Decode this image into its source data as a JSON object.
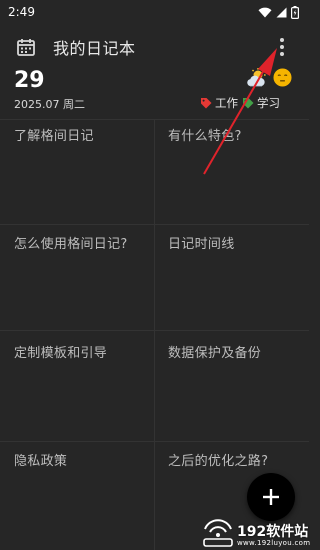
{
  "status_bar": {
    "time": "2:49"
  },
  "app_bar": {
    "title": "我的日记本"
  },
  "date": {
    "day": "29",
    "subtitle": "2025.07 周二"
  },
  "tags": [
    {
      "label": "工作",
      "color": "#e53935"
    },
    {
      "label": "学习",
      "color": "#43a047"
    }
  ],
  "grid": {
    "cells": [
      {
        "title": "了解格间日记"
      },
      {
        "title": "有什么特色?"
      },
      {
        "title": "怎么使用格间日记?"
      },
      {
        "title": "日记时间线"
      },
      {
        "title": "定制模板和引导"
      },
      {
        "title": "数据保护及备份"
      },
      {
        "title": "隐私政策"
      },
      {
        "title": "之后的优化之路?"
      }
    ]
  },
  "icons": {
    "calendar": "calendar-icon",
    "more": "more-vert-icon",
    "weather": "partly-cloudy-icon",
    "mood": "neutral-face-icon",
    "fab": "plus-icon"
  },
  "colors": {
    "background": "#262626",
    "annotation_arrow": "#e0232b",
    "fab": "#000000",
    "mood": "#f5b400"
  },
  "watermark": {
    "main": "192软件站",
    "sub": "www.192luyou.com"
  }
}
